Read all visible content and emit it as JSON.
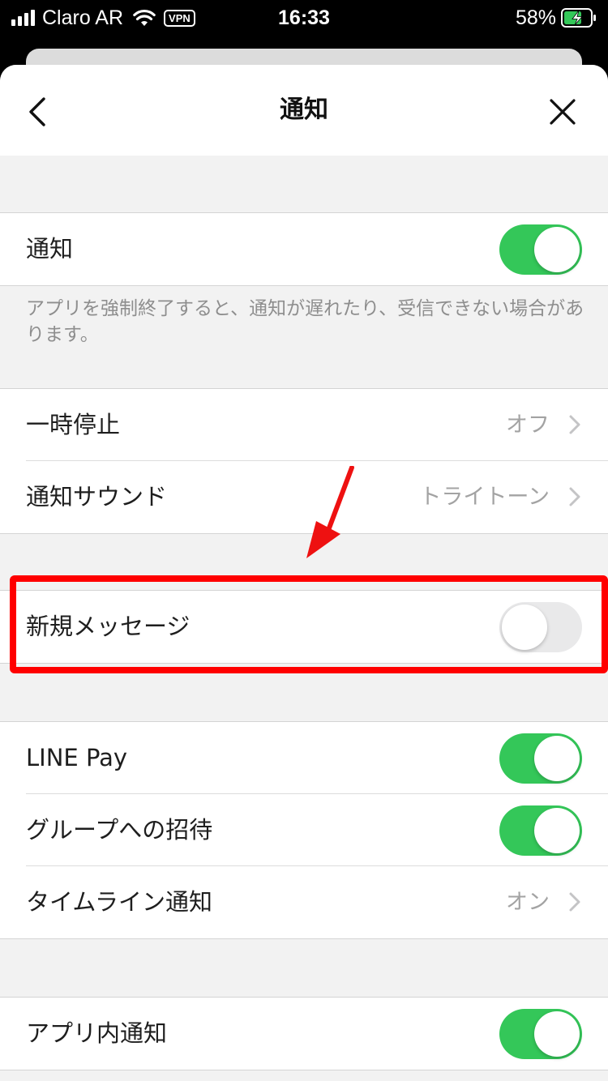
{
  "status_bar": {
    "carrier": "Claro AR",
    "vpn": "VPN",
    "time": "16:33",
    "battery": "58%"
  },
  "header": {
    "title": "通知"
  },
  "groups": {
    "main": {
      "notifications": {
        "label": "通知",
        "on": true
      },
      "footnote": "アプリを強制終了すると、通知が遅れたり、受信できない場合があります。"
    },
    "settings": [
      {
        "label": "一時停止",
        "value": "オフ"
      },
      {
        "label": "通知サウンド",
        "value": "トライトーン"
      }
    ],
    "new_message": {
      "label": "新規メッセージ",
      "on": false
    },
    "types": [
      {
        "label": "LINE Pay",
        "on": true
      },
      {
        "label": "グループへの招待",
        "on": true
      },
      {
        "label": "タイムライン通知",
        "value": "オン"
      }
    ],
    "in_app": {
      "label": "アプリ内通知",
      "on": true
    }
  },
  "colors": {
    "toggle_on": "#34c759",
    "toggle_off": "#e9e9ea",
    "highlight": "#ff0000"
  }
}
